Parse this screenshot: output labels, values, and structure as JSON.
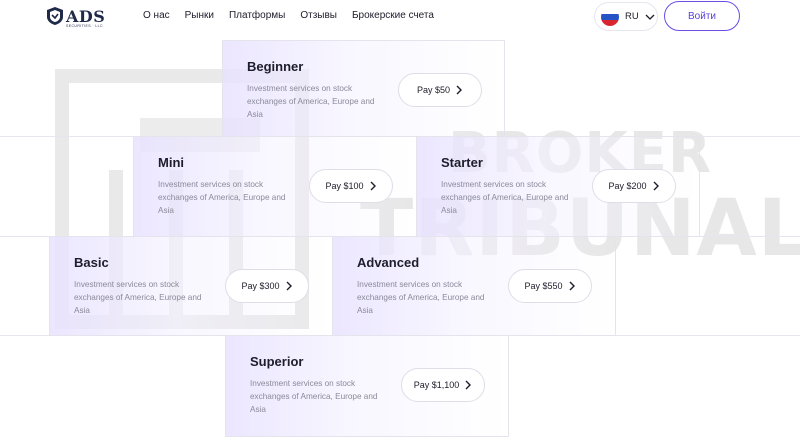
{
  "header": {
    "logo_text": "ADS",
    "logo_subtext": "SECURITIES · LLC",
    "nav": [
      "О нас",
      "Рынки",
      "Платформы",
      "Отзывы",
      "Брокерские счета"
    ],
    "lang": "RU",
    "login_label": "Войти"
  },
  "watermark": {
    "line1": "BROKER",
    "line2": "TRIBUNAL"
  },
  "plans": [
    {
      "name": "Beginner",
      "desc": "Investment services on stock exchanges of America, Europe and Asia",
      "pay": "Pay $50"
    },
    {
      "name": "Mini",
      "desc": "Investment services on stock exchanges of America, Europe and Asia",
      "pay": "Pay $100"
    },
    {
      "name": "Starter",
      "desc": "Investment services on stock exchanges of America, Europe and Asia",
      "pay": "Pay $200"
    },
    {
      "name": "Basic",
      "desc": "Investment services on stock exchanges of America, Europe and Asia",
      "pay": "Pay $300"
    },
    {
      "name": "Advanced",
      "desc": "Investment services on stock exchanges of America, Europe and Asia",
      "pay": "Pay $550"
    },
    {
      "name": "Superior",
      "desc": "Investment services on stock exchanges of America, Europe and Asia",
      "pay": "Pay $1,100"
    }
  ],
  "icons": {
    "pay_arrow": "chevron-right-icon",
    "lang_chevron": "chevron-down-icon",
    "flag": "russia-flag-icon"
  },
  "colors": {
    "accent": "#5a3fd6",
    "card_tint": "#e8e2ff",
    "border": "#e4e4ec"
  }
}
